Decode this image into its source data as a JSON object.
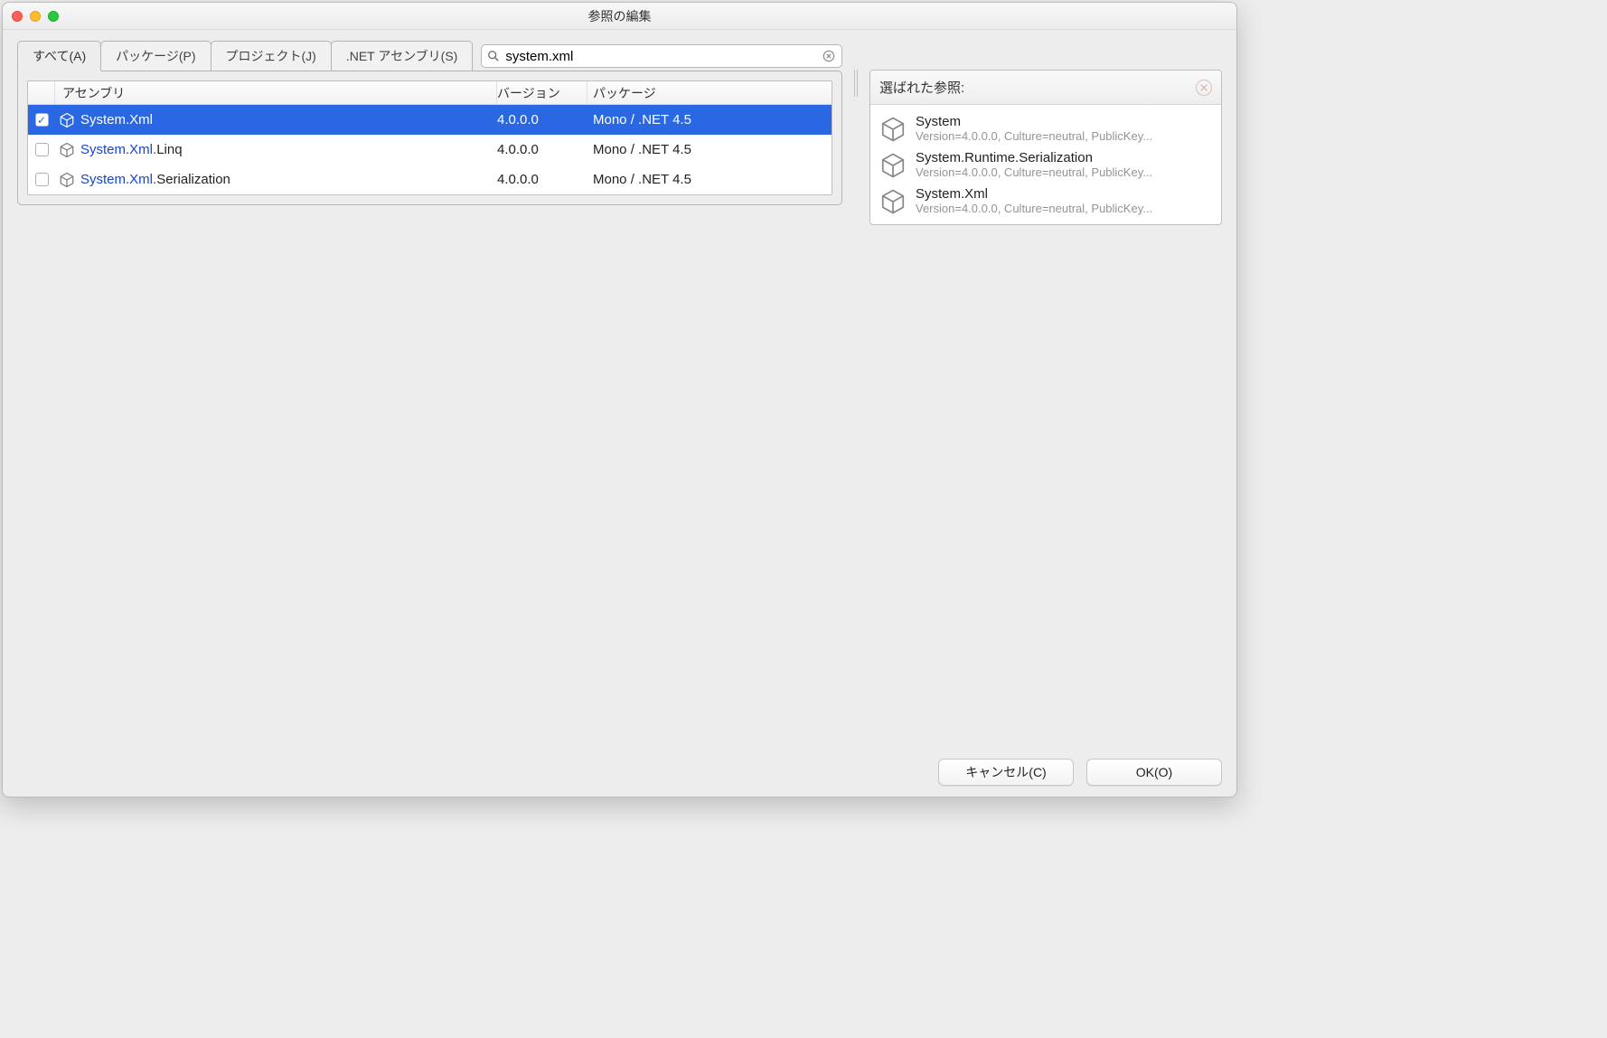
{
  "window": {
    "title": "参照の編集"
  },
  "tabs": [
    {
      "label": "すべて(A)",
      "active": true
    },
    {
      "label": "パッケージ(P)",
      "active": false
    },
    {
      "label": "プロジェクト(J)",
      "active": false
    },
    {
      "label": ".NET アセンブリ(S)",
      "active": false
    }
  ],
  "search": {
    "value": "system.xml"
  },
  "columns": {
    "assembly": "アセンブリ",
    "version": "バージョン",
    "package": "パッケージ"
  },
  "rows": [
    {
      "checked": true,
      "selected": true,
      "match": "System.Xml",
      "rest": "",
      "version": "4.0.0.0",
      "package": "Mono / .NET 4.5"
    },
    {
      "checked": false,
      "selected": false,
      "match": "System.Xml.",
      "rest": "Linq",
      "version": "4.0.0.0",
      "package": "Mono / .NET 4.5"
    },
    {
      "checked": false,
      "selected": false,
      "match": "System.Xml.",
      "rest": "Serialization",
      "version": "4.0.0.0",
      "package": "Mono / .NET 4.5"
    }
  ],
  "selectedPanel": {
    "title": "選ばれた参照:",
    "items": [
      {
        "name": "System",
        "sub": "Version=4.0.0.0, Culture=neutral, PublicKey..."
      },
      {
        "name": "System.Runtime.Serialization",
        "sub": "Version=4.0.0.0, Culture=neutral, PublicKey..."
      },
      {
        "name": "System.Xml",
        "sub": "Version=4.0.0.0, Culture=neutral, PublicKey..."
      }
    ]
  },
  "buttons": {
    "cancel": "キャンセル(C)",
    "ok": "OK(O)"
  }
}
